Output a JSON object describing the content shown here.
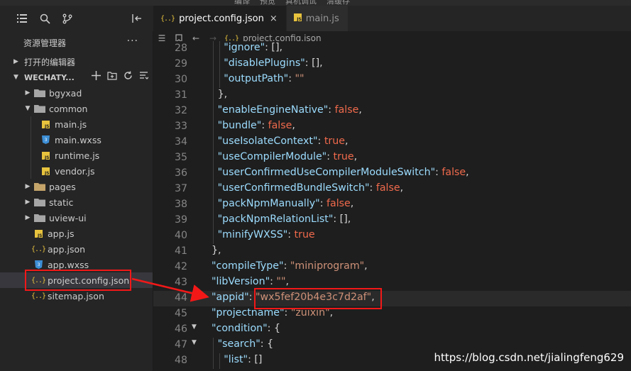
{
  "menu": {
    "items": [
      "编译",
      "预览",
      "真机调试",
      "清缓存"
    ]
  },
  "sidebar": {
    "title": "资源管理器",
    "more": "···",
    "sections": {
      "open_editors": "打开的编辑器",
      "workspace": "WECHATY..."
    },
    "tree": [
      {
        "label": "bgyxad",
        "type": "folder",
        "depth": 0,
        "expanded": false
      },
      {
        "label": "common",
        "type": "folder",
        "depth": 0,
        "expanded": true
      },
      {
        "label": "main.js",
        "type": "js",
        "depth": 1
      },
      {
        "label": "main.wxss",
        "type": "css",
        "depth": 1
      },
      {
        "label": "runtime.js",
        "type": "js",
        "depth": 1
      },
      {
        "label": "vendor.js",
        "type": "js",
        "depth": 1
      },
      {
        "label": "pages",
        "type": "folder-red",
        "depth": 0,
        "expanded": false
      },
      {
        "label": "static",
        "type": "folder",
        "depth": 0,
        "expanded": false
      },
      {
        "label": "uview-ui",
        "type": "folder",
        "depth": 0,
        "expanded": false
      },
      {
        "label": "app.js",
        "type": "js",
        "depth": 0
      },
      {
        "label": "app.json",
        "type": "json",
        "depth": 0
      },
      {
        "label": "app.wxss",
        "type": "css",
        "depth": 0
      },
      {
        "label": "project.config.json",
        "type": "json",
        "depth": 0,
        "selected": true
      },
      {
        "label": "sitemap.json",
        "type": "json",
        "depth": 0
      }
    ]
  },
  "tabs": [
    {
      "label": "project.config.json",
      "active": true,
      "icon": "json-icon",
      "close": "×"
    },
    {
      "label": "main.js",
      "active": false,
      "icon": "js-icon"
    }
  ],
  "breadcrumb": {
    "file": "project.config.json"
  },
  "code": {
    "lines": [
      {
        "n": "28",
        "indent": 2,
        "tokens": [
          [
            "key",
            "\"ignore\""
          ],
          [
            "p",
            ": "
          ],
          [
            "p",
            "[],"
          ]
        ]
      },
      {
        "n": "29",
        "indent": 2,
        "tokens": [
          [
            "key",
            "\"disablePlugins\""
          ],
          [
            "p",
            ": "
          ],
          [
            "p",
            "[],"
          ]
        ]
      },
      {
        "n": "30",
        "indent": 2,
        "tokens": [
          [
            "key",
            "\"outputPath\""
          ],
          [
            "p",
            ": "
          ],
          [
            "str",
            "\"\""
          ]
        ]
      },
      {
        "n": "31",
        "indent": 1,
        "tokens": [
          [
            "p",
            "},"
          ]
        ]
      },
      {
        "n": "32",
        "indent": 1,
        "tokens": [
          [
            "key",
            "\"enableEngineNative\""
          ],
          [
            "p",
            ": "
          ],
          [
            "kw",
            "false"
          ],
          [
            "p",
            ","
          ]
        ]
      },
      {
        "n": "33",
        "indent": 1,
        "tokens": [
          [
            "key",
            "\"bundle\""
          ],
          [
            "p",
            ": "
          ],
          [
            "kw",
            "false"
          ],
          [
            "p",
            ","
          ]
        ]
      },
      {
        "n": "34",
        "indent": 1,
        "tokens": [
          [
            "key",
            "\"useIsolateContext\""
          ],
          [
            "p",
            ": "
          ],
          [
            "kw",
            "true"
          ],
          [
            "p",
            ","
          ]
        ]
      },
      {
        "n": "35",
        "indent": 1,
        "tokens": [
          [
            "key",
            "\"useCompilerModule\""
          ],
          [
            "p",
            ": "
          ],
          [
            "kw",
            "true"
          ],
          [
            "p",
            ","
          ]
        ]
      },
      {
        "n": "36",
        "indent": 1,
        "tokens": [
          [
            "key",
            "\"userConfirmedUseCompilerModuleSwitch\""
          ],
          [
            "p",
            ": "
          ],
          [
            "kw",
            "false"
          ],
          [
            "p",
            ","
          ]
        ]
      },
      {
        "n": "37",
        "indent": 1,
        "tokens": [
          [
            "key",
            "\"userConfirmedBundleSwitch\""
          ],
          [
            "p",
            ": "
          ],
          [
            "kw",
            "false"
          ],
          [
            "p",
            ","
          ]
        ]
      },
      {
        "n": "38",
        "indent": 1,
        "tokens": [
          [
            "key",
            "\"packNpmManually\""
          ],
          [
            "p",
            ": "
          ],
          [
            "kw",
            "false"
          ],
          [
            "p",
            ","
          ]
        ]
      },
      {
        "n": "39",
        "indent": 1,
        "tokens": [
          [
            "key",
            "\"packNpmRelationList\""
          ],
          [
            "p",
            ": "
          ],
          [
            "p",
            "[],"
          ]
        ]
      },
      {
        "n": "40",
        "indent": 1,
        "tokens": [
          [
            "key",
            "\"minifyWXSS\""
          ],
          [
            "p",
            ": "
          ],
          [
            "kw",
            "true"
          ]
        ]
      },
      {
        "n": "41",
        "indent": 0,
        "tokens": [
          [
            "p",
            "},"
          ]
        ]
      },
      {
        "n": "42",
        "indent": 0,
        "tokens": [
          [
            "key",
            "\"compileType\""
          ],
          [
            "p",
            ": "
          ],
          [
            "str",
            "\"miniprogram\""
          ],
          [
            "p",
            ","
          ]
        ]
      },
      {
        "n": "43",
        "indent": 0,
        "tokens": [
          [
            "key",
            "\"libVersion\""
          ],
          [
            "p",
            ": "
          ],
          [
            "str",
            "\"\""
          ],
          [
            "p",
            ","
          ]
        ]
      },
      {
        "n": "44",
        "indent": 0,
        "hl": true,
        "tokens": [
          [
            "key",
            "\"appid\""
          ],
          [
            "p",
            ": "
          ],
          [
            "str",
            "\"wx5fef20b4e3c7d2af\""
          ],
          [
            "p",
            ","
          ]
        ]
      },
      {
        "n": "45",
        "indent": 0,
        "tokens": [
          [
            "key",
            "\"projectname\""
          ],
          [
            "p",
            ": "
          ],
          [
            "str",
            "\"zuixin\""
          ],
          [
            "p",
            ","
          ]
        ]
      },
      {
        "n": "46",
        "indent": 0,
        "fold": true,
        "tokens": [
          [
            "key",
            "\"condition\""
          ],
          [
            "p",
            ": {"
          ]
        ]
      },
      {
        "n": "47",
        "indent": 1,
        "fold": true,
        "tokens": [
          [
            "key",
            "\"search\""
          ],
          [
            "p",
            ": {"
          ]
        ]
      },
      {
        "n": "48",
        "indent": 2,
        "tokens": [
          [
            "key",
            "\"list\""
          ],
          [
            "p",
            ": "
          ],
          [
            "p",
            "[]"
          ]
        ]
      }
    ]
  },
  "watermark": "https://blog.csdn.net/jialingfeng629",
  "colors": {
    "annotation": "#f21818",
    "keyword": "#f06a4c",
    "key": "#9cdcfe",
    "string": "#ce9178"
  }
}
